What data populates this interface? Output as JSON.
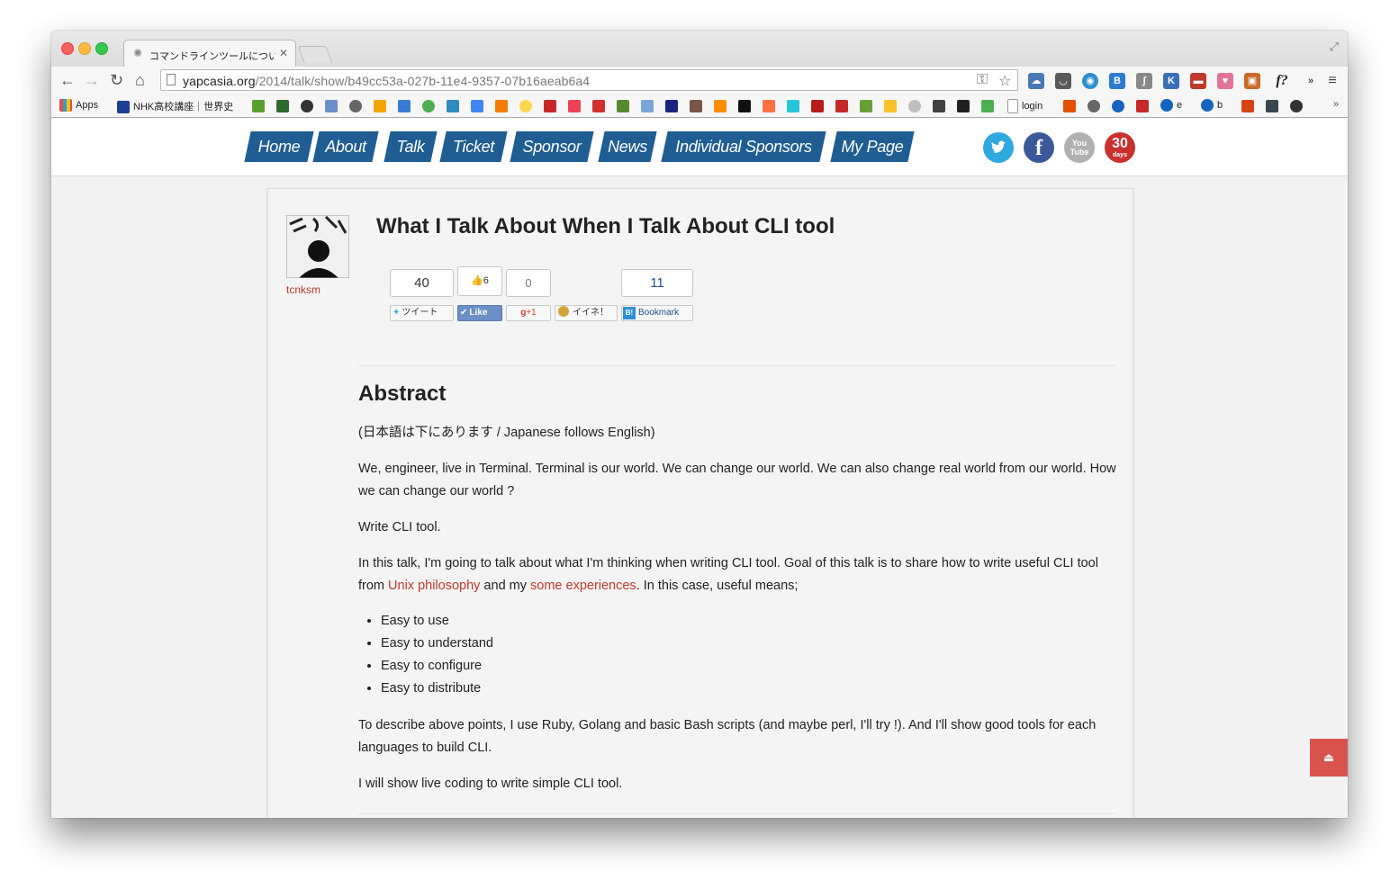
{
  "browser": {
    "tab_title": "コマンドラインツールについ",
    "url_host": "yapcasia.org",
    "url_path": "/2014/talk/show/b49cc53a-027b-11e4-9357-07b16aeab6a4",
    "bookmarks": {
      "apps": "Apps",
      "nhk": "NHK高校講座｜世界史",
      "login": "login",
      "e": "e",
      "b": "b"
    },
    "ext_f_label": "f?"
  },
  "site_nav": {
    "items": [
      "Home",
      "About",
      "Talk",
      "Ticket",
      "Sponsor",
      "News",
      "Individual Sponsors",
      "My Page"
    ],
    "social_30": "30",
    "social_30_sub": "days",
    "youtube_label": "You\nTube"
  },
  "talk": {
    "title": "What I Talk About When I Talk About CLI tool",
    "author": "tcnksm"
  },
  "share": {
    "tweet_count": "40",
    "tweet_label": "ツイート",
    "like_count": "6",
    "like_label": "Like",
    "gplus_count": "0",
    "gplus_label": "+1",
    "mixi_label": "イイネ！",
    "hatena_count": "11",
    "hatena_label": "Bookmark"
  },
  "abstract": {
    "heading": "Abstract",
    "p1": "(日本語は下にあります / Japanese follows English)",
    "p2": "We, engineer, live in Terminal. Terminal is our world. We can change our world. We can also change real world from our world. How we can change our world ?",
    "p3": "Write CLI tool.",
    "p4_before": "In this talk, I'm going to talk about what I'm thinking when writing CLI tool. Goal of this talk is to share how to write useful CLI tool from ",
    "p4_link1": "Unix philosophy",
    "p4_mid": " and my ",
    "p4_link2": "some experiences",
    "p4_after": ". In this case, useful means;",
    "list": [
      "Easy to use",
      "Easy to understand",
      "Easy to configure",
      "Easy to distribute"
    ],
    "p5": "To describe above points, I use Ruby, Golang and basic Bash scripts (and maybe perl, I'll try !). And I'll show good tools for each languages to build CLI.",
    "p6": "I will show live coding to write simple CLI tool."
  },
  "colors": {
    "nav_blue": "#1f5d92",
    "link_red": "#c0392b",
    "twitter": "#2fa8e0",
    "facebook": "#3b5998",
    "youtube": "#b0b0b0",
    "thirty_days": "#c9312e",
    "back_to_top": "#d9534f"
  }
}
